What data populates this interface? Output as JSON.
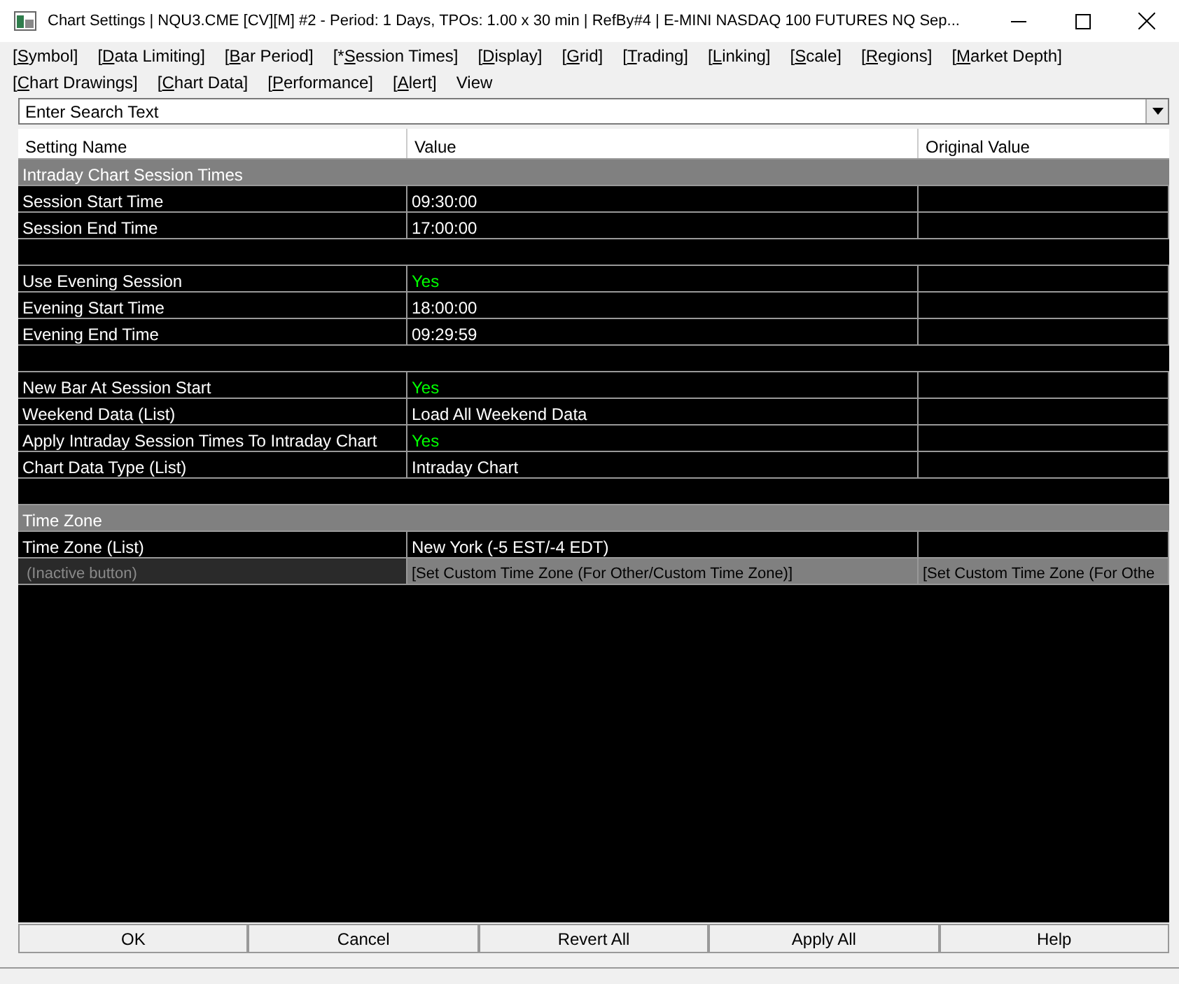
{
  "window": {
    "title": "Chart Settings | NQU3.CME [CV][M] #2 - Period: 1 Days, TPOs: 1.00 x 30 min   | RefBy#4 | E-MINI NASDAQ 100 FUTURES NQ Sep..."
  },
  "menu": [
    [
      {
        "pre": "[",
        "key": "S",
        "post": "ymbol]"
      },
      {
        "pre": "[",
        "key": "D",
        "post": "ata Limiting]"
      },
      {
        "pre": "[",
        "key": "B",
        "post": "ar Period]"
      },
      {
        "pre": "[*",
        "key": "S",
        "post": "ession Times]"
      },
      {
        "pre": "[",
        "key": "D",
        "post": "isplay]"
      },
      {
        "pre": "[",
        "key": "G",
        "post": "rid]"
      },
      {
        "pre": "[",
        "key": "T",
        "post": "rading]"
      },
      {
        "pre": "[",
        "key": "L",
        "post": "inking]"
      },
      {
        "pre": "[",
        "key": "S",
        "post": "cale]"
      },
      {
        "pre": "[",
        "key": "R",
        "post": "egions]"
      },
      {
        "pre": "[",
        "key": "M",
        "post": "arket Depth]"
      }
    ],
    [
      {
        "pre": "[",
        "key": "C",
        "post": "hart Drawings]"
      },
      {
        "pre": "[",
        "key": "C",
        "post": "hart Data]"
      },
      {
        "pre": "[",
        "key": "P",
        "post": "erformance]"
      },
      {
        "pre": "[",
        "key": "A",
        "post": "lert]"
      },
      {
        "pre": "View"
      }
    ]
  ],
  "search": {
    "value": "Enter Search Text"
  },
  "table": {
    "columns": [
      "Setting Name",
      "Value",
      "Original Value"
    ],
    "rows": [
      {
        "kind": "section",
        "label": "Intraday Chart Session Times"
      },
      {
        "kind": "row",
        "name": "Session Start Time",
        "value": "09:30:00"
      },
      {
        "kind": "row",
        "name": "Session End Time",
        "value": "17:00:00"
      },
      {
        "kind": "blank"
      },
      {
        "kind": "row",
        "name": "Use Evening Session",
        "value": "Yes",
        "color": "#00ff00"
      },
      {
        "kind": "row",
        "name": "Evening Start Time",
        "value": "18:00:00"
      },
      {
        "kind": "row",
        "name": "Evening End Time",
        "value": "09:29:59"
      },
      {
        "kind": "blank"
      },
      {
        "kind": "row",
        "name": "New Bar At Session Start",
        "value": "Yes",
        "color": "#00ff00"
      },
      {
        "kind": "row",
        "name": "Weekend Data (List)",
        "value": "Load All Weekend Data"
      },
      {
        "kind": "row",
        "name": "Apply Intraday Session Times To Intraday Chart",
        "value": "Yes",
        "color": "#00ff00"
      },
      {
        "kind": "row",
        "name": "Chart Data Type (List)",
        "value": "Intraday Chart"
      },
      {
        "kind": "blank"
      },
      {
        "kind": "section",
        "label": "Time Zone"
      },
      {
        "kind": "row",
        "name": "Time Zone (List)",
        "value": "New York (-5 EST/-4 EDT)"
      },
      {
        "kind": "button_row",
        "name": "(Inactive button)",
        "value": "[Set Custom Time Zone (For Other/Custom Time Zone)]",
        "original": "[Set Custom Time Zone (For Othe"
      }
    ]
  },
  "buttons": [
    "OK",
    "Cancel",
    "Revert All",
    "Apply All",
    "Help"
  ]
}
